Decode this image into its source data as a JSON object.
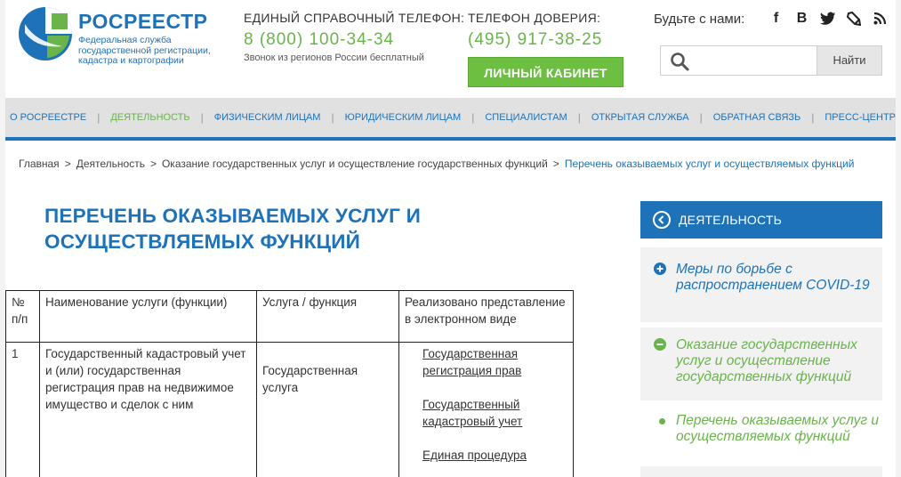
{
  "header": {
    "brand_name": "РОСРЕЕСТР",
    "brand_subtitle_lines": [
      "Федеральная служба",
      "государственной регистрации,",
      "кадастра и картографии"
    ],
    "hotline": {
      "label": "ЕДИНЫЙ СПРАВОЧНЫЙ ТЕЛЕФОН:",
      "number": "8 (800) 100-34-34",
      "note": "Звонок из регионов России бесплатный"
    },
    "trust_line": {
      "label": "ТЕЛЕФОН ДОВЕРИЯ:",
      "number": "(495) 917-38-25"
    },
    "cabinet_button": "ЛИЧНЫЙ КАБИНЕТ",
    "social_label": "Будьте с нами:",
    "social_icons": [
      {
        "name": "facebook-icon",
        "glyph": "f"
      },
      {
        "name": "vk-icon",
        "glyph": "B"
      },
      {
        "name": "twitter-icon",
        "glyph": "🐦"
      },
      {
        "name": "livejournal-icon",
        "glyph": "✎"
      },
      {
        "name": "rss-icon",
        "glyph": "◉"
      }
    ],
    "search": {
      "placeholder": "",
      "button": "Найти"
    }
  },
  "nav": {
    "items": [
      {
        "label": "О РОСРЕЕСТРЕ",
        "active": false
      },
      {
        "label": "ДЕЯТЕЛЬНОСТЬ",
        "active": true
      },
      {
        "label": "ФИЗИЧЕСКИМ ЛИЦАМ",
        "active": false
      },
      {
        "label": "ЮРИДИЧЕСКИМ ЛИЦАМ",
        "active": false
      },
      {
        "label": "СПЕЦИАЛИСТАМ",
        "active": false
      },
      {
        "label": "ОТКРЫТАЯ СЛУЖБА",
        "active": false
      },
      {
        "label": "ОБРАТНАЯ СВЯЗЬ",
        "active": false
      },
      {
        "label": "ПРЕСС-ЦЕНТР",
        "active": false
      }
    ]
  },
  "breadcrumb": [
    "Главная",
    "Деятельность",
    "Оказание государственных услуг и осуществление государственных функций",
    "Перечень оказываемых услуг и осуществляемых функций"
  ],
  "page_title": "ПЕРЕЧЕНЬ ОКАЗЫВАЕМЫХ УСЛУГ И ОСУЩЕСТВЛЯЕМЫХ ФУНКЦИЙ",
  "table": {
    "headers": [
      "№ п/п",
      "Наименование услуги (функции)",
      "Услуга / функция",
      "Реализовано представление в электронном виде"
    ],
    "rows": [
      {
        "num": "1",
        "name": "Государственный кадастровый учет и (или) государственная регистрация прав на недвижимое имущество и сделок с ним",
        "type": "Государственная услуга",
        "links": [
          "Государственная регистрация прав",
          "Государственный кадастровый учет",
          "Единая процедура"
        ]
      }
    ]
  },
  "sidebar": {
    "header": "ДЕЯТЕЛЬНОСТЬ",
    "items": [
      {
        "label": "Меры по борьбе с распространением COVID-19",
        "state": "collapsed"
      },
      {
        "label": "Оказание государственных услуг и осуществление государственных функций",
        "state": "expanded"
      },
      {
        "label": "Перечень оказываемых услуг и осуществляемых функций",
        "state": "current"
      }
    ]
  },
  "colors": {
    "brand_blue": "#1d72b8",
    "brand_green": "#69b44b",
    "button_green": "#6cbf40",
    "nav_bg": "#e1e1e1"
  }
}
